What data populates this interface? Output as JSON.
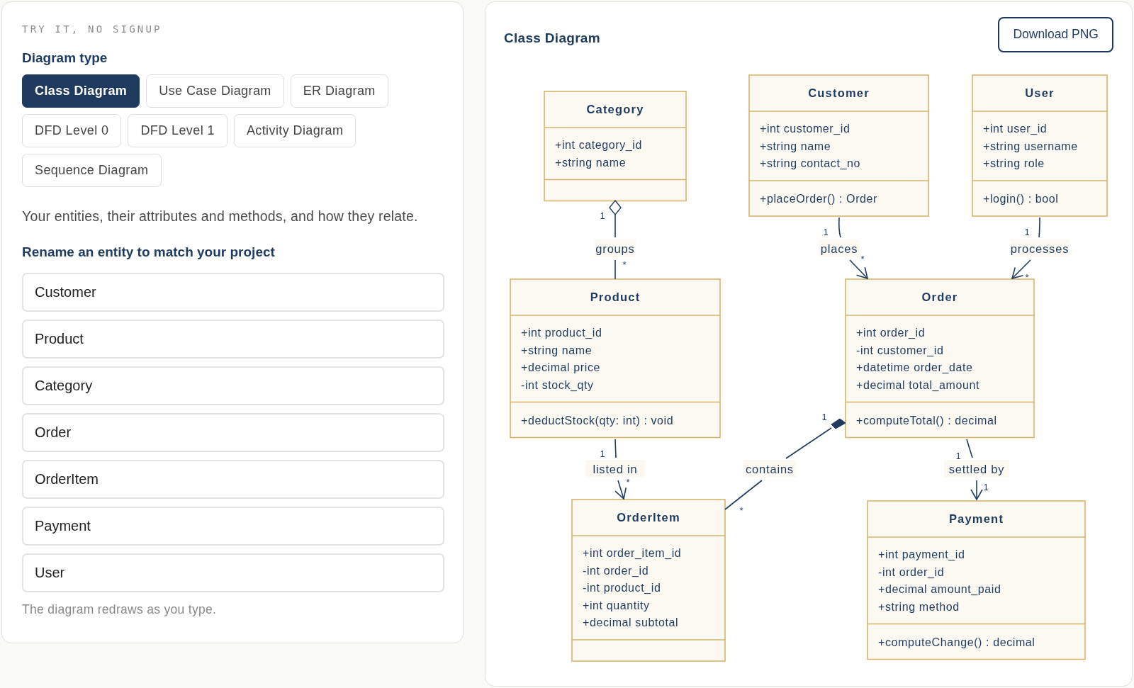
{
  "sidebar": {
    "eyebrow": "TRY IT, NO SIGNUP",
    "type_heading": "Diagram type",
    "types": [
      {
        "label": "Class Diagram",
        "selected": true
      },
      {
        "label": "Use Case Diagram",
        "selected": false
      },
      {
        "label": "ER Diagram",
        "selected": false
      },
      {
        "label": "DFD Level 0",
        "selected": false
      },
      {
        "label": "DFD Level 1",
        "selected": false
      },
      {
        "label": "Activity Diagram",
        "selected": false
      },
      {
        "label": "Sequence Diagram",
        "selected": false
      }
    ],
    "description": "Your entities, their attributes and methods, and how they relate.",
    "rename_heading": "Rename an entity to match your project",
    "entities": [
      {
        "value": "Customer"
      },
      {
        "value": "Product"
      },
      {
        "value": "Category"
      },
      {
        "value": "Order"
      },
      {
        "value": "OrderItem"
      },
      {
        "value": "Payment"
      },
      {
        "value": "User"
      }
    ],
    "hint": "The diagram redraws as you type."
  },
  "diagram": {
    "title": "Class Diagram",
    "download_button": "Download PNG",
    "classes": [
      {
        "name": "Category",
        "attributes": [
          "+int category_id",
          "+string name"
        ]
      },
      {
        "name": "Customer",
        "attributes": [
          "+int customer_id",
          "+string name",
          "+string contact_no"
        ],
        "methods": [
          "+placeOrder() : Order"
        ]
      },
      {
        "name": "User",
        "attributes": [
          "+int user_id",
          "+string username",
          "+string role"
        ],
        "methods": [
          "+login() : bool"
        ]
      },
      {
        "name": "Product",
        "attributes": [
          "+int product_id",
          "+string name",
          "+decimal price",
          "-int stock_qty"
        ],
        "methods": [
          "+deductStock(qty: int) : void"
        ]
      },
      {
        "name": "Order",
        "attributes": [
          "+int order_id",
          "-int customer_id",
          "+datetime order_date",
          "+decimal total_amount"
        ],
        "methods": [
          "+computeTotal() : decimal"
        ]
      },
      {
        "name": "OrderItem",
        "attributes": [
          "+int order_item_id",
          "-int order_id",
          "-int product_id",
          "+int quantity",
          "+decimal subtotal"
        ]
      },
      {
        "name": "Payment",
        "attributes": [
          "+int payment_id",
          "-int order_id",
          "+decimal amount_paid",
          "+string method"
        ],
        "methods": [
          "+computeChange() : decimal"
        ]
      }
    ],
    "relations": [
      {
        "kind": "aggregation",
        "label": "groups",
        "from_mult": "1",
        "to_mult": "*"
      },
      {
        "kind": "navigable",
        "label": "places",
        "from_mult": "1",
        "to_mult": "*"
      },
      {
        "kind": "navigable",
        "label": "processes",
        "from_mult": "1",
        "to_mult": "*"
      },
      {
        "kind": "navigable",
        "label": "listed in",
        "from_mult": "1",
        "to_mult": "*"
      },
      {
        "kind": "composition",
        "label": "contains",
        "from_mult": "1",
        "to_mult": "*"
      },
      {
        "kind": "navigable",
        "label": "settled by",
        "from_mult": "1",
        "to_mult": "1"
      }
    ]
  }
}
